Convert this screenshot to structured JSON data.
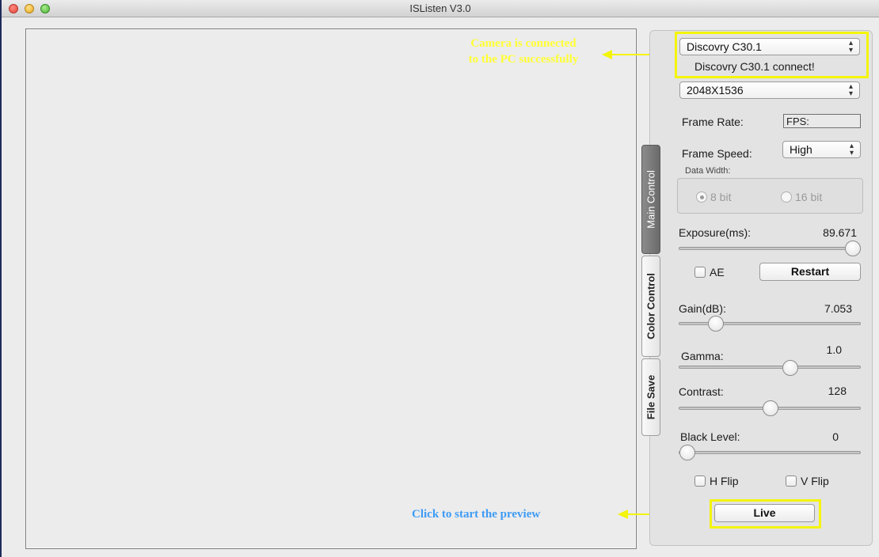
{
  "window": {
    "title": "ISListen V3.0"
  },
  "annotations": {
    "camera_connected": "Camera is connected\nto the PC successfully",
    "click_preview": "Click to start the preview",
    "yellow": "#ffff33",
    "blue": "#3d9bf5",
    "highlight": "#f4f40c"
  },
  "tabs": [
    "Main Control",
    "Color Control",
    "File Save"
  ],
  "active_tab": "Main Control",
  "camera": {
    "selected": "Discovry C30.1",
    "status": "Discovry C30.1 connect!",
    "resolution": "2048X1536"
  },
  "frame_rate": {
    "label": "Frame Rate:",
    "value": "FPS:"
  },
  "frame_speed": {
    "label": "Frame Speed:",
    "selected": "High"
  },
  "data_width": {
    "label": "Data Width:",
    "option_8": "8 bit",
    "option_16": "16 bit",
    "selected": "8 bit"
  },
  "exposure": {
    "label": "Exposure(ms):",
    "value": "89.671",
    "slider_fraction": 1.0
  },
  "ae": {
    "label": "AE",
    "checked": false
  },
  "restart_label": "Restart",
  "gain": {
    "label": "Gain(dB):",
    "value": "7.053",
    "slider_fraction": 0.2
  },
  "gamma": {
    "label": "Gamma:",
    "value": "1.0",
    "slider_fraction": 0.6
  },
  "contrast": {
    "label": "Contrast:",
    "value": "128",
    "slider_fraction": 0.5
  },
  "black_level": {
    "label": "Black Level:",
    "value": "0",
    "slider_fraction": 0.0
  },
  "h_flip": {
    "label": "H Flip",
    "checked": false
  },
  "v_flip": {
    "label": "V Flip",
    "checked": false
  },
  "live_label": "Live"
}
